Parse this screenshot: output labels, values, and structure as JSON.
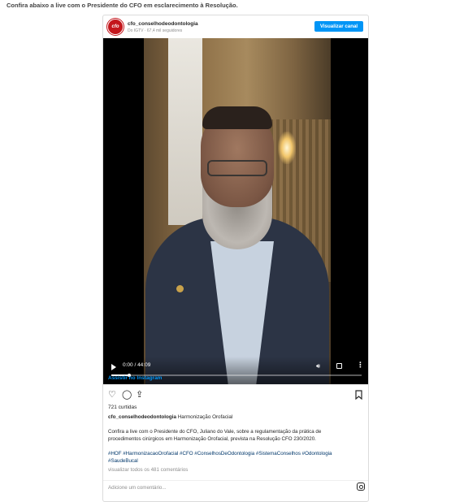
{
  "intro_text": "Confira abaixo a live com o Presidente do CFO em esclarecimento à Resolução.",
  "colors": {
    "accent": "#0095f6",
    "brand": "#c4161c",
    "hashtag": "#00376b"
  },
  "post": {
    "avatar_text": "cfo",
    "username": "cfo_conselhodeodontologia",
    "source": "Do IGTV",
    "separator": "·",
    "followers": "67,4 mil seguidores",
    "view_channel_label": "Visualizar canal",
    "video": {
      "time": "0:00 / 44:09",
      "progress": 0.07,
      "icons": [
        "play-icon",
        "volume-icon",
        "fullscreen-icon",
        "more-options-icon"
      ]
    },
    "watch_on_instagram": "Assistir no Instagram",
    "likes": "721 curtidas",
    "caption_user": "cfo_conselhodeodontologia",
    "caption_title": "Harmonização Orofacial",
    "caption_body": "Confira a live com o Presidente do CFO, Juliano do Vale, sobre a regulamentação da prática de procedimentos cirúrgicos em Harmonização Orofacial, prevista na Resolução CFO 230/2020.",
    "hashtags": "#HOF #HarmonizacaoOrofacial #CFO #ConselhosDeOdontologia #SistemaConselhos #Odontologia #SaudeBucal",
    "view_comments": "visualizar todos os 481 comentários",
    "comment_placeholder": "Adicione um comentário..."
  }
}
